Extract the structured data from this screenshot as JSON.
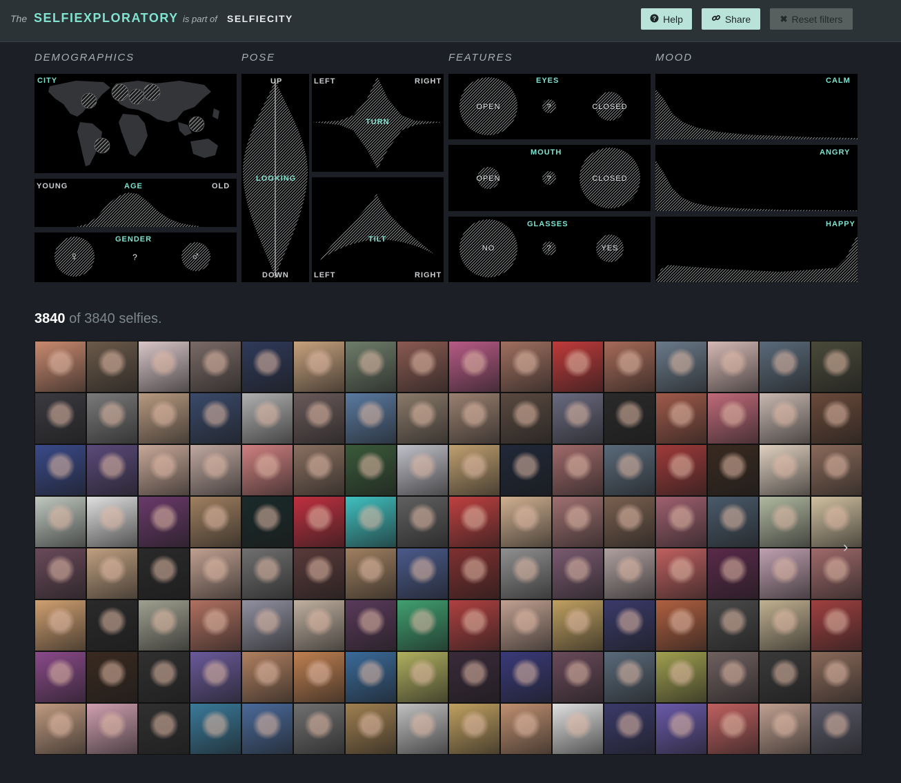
{
  "header": {
    "the": "The",
    "brand": "SELFIEXPLORATORY",
    "is_part_of": "is part of",
    "parent": "SELFIECITY",
    "help_label": "Help",
    "share_label": "Share",
    "reset_label": "Reset filters",
    "help_icon": "question-circle-icon",
    "share_icon": "link-icon",
    "reset_icon": "close-icon"
  },
  "sections": {
    "demographics": "DEMOGRAPHICS",
    "pose": "POSE",
    "features": "FEATURES",
    "mood": "MOOD"
  },
  "demographics": {
    "city_label": "CITY",
    "age_label": "AGE",
    "age_young": "YOUNG",
    "age_old": "OLD",
    "gender_label": "GENDER",
    "gender_female": "♀",
    "gender_unknown": "?",
    "gender_male": "♂"
  },
  "pose": {
    "looking_label": "LOOKING",
    "up": "UP",
    "down": "DOWN",
    "turn_label": "TURN",
    "turn_left": "LEFT",
    "turn_right": "RIGHT",
    "tilt_label": "TILT",
    "tilt_left": "LEFT",
    "tilt_right": "RIGHT"
  },
  "features": {
    "eyes": {
      "label": "EYES",
      "a": "OPEN",
      "q": "?",
      "b": "CLOSED"
    },
    "mouth": {
      "label": "MOUTH",
      "a": "OPEN",
      "q": "?",
      "b": "CLOSED"
    },
    "glasses": {
      "label": "GLASSES",
      "a": "NO",
      "q": "?",
      "b": "YES"
    }
  },
  "mood": {
    "calm": "CALM",
    "angry": "ANGRY",
    "happy": "HAPPY"
  },
  "results": {
    "shown": "3840",
    "rest": "of 3840 selfies."
  },
  "colors": {
    "accent": "#7fe3cf",
    "button_bg": "#b9e2d8",
    "panel_bg": "#000000",
    "page_bg": "#1c2026"
  },
  "thumb_colors": [
    "#c98a6f",
    "#6b5a4a",
    "#d9c6c9",
    "#7a6a66",
    "#2f3a5a",
    "#c7a27d",
    "#6e7d6a",
    "#8a5a52",
    "#b85a86",
    "#a07060",
    "#c03a3a",
    "#a66a58",
    "#6a7a8a",
    "#d5b9b5",
    "#5a6a7a",
    "#4a4a3a",
    "#3a3a40",
    "#7a7a7a",
    "#b89a80",
    "#3a4a6a",
    "#b0b0b0",
    "#6a5a5a",
    "#5a7aa0",
    "#8a7a6a",
    "#9a8070",
    "#5a4a40",
    "#6a6a80",
    "#2a2a2a",
    "#a05a4a",
    "#c06a7a",
    "#c8b8b0",
    "#6a4a3a",
    "#3a4a8a",
    "#5a4a7a",
    "#c8a898",
    "#c0a8a0",
    "#d08080",
    "#8a7060",
    "#3a5a3a",
    "#c0c0c8",
    "#c0a070",
    "#202838",
    "#a06a6a",
    "#5a6a7a",
    "#a03a3a",
    "#3a2a20",
    "#e0d0c0",
    "#8a6a5a",
    "#c0c8c0",
    "#e0e0e0",
    "#6a3a6a",
    "#a08060",
    "#1a2a2a",
    "#c03040",
    "#40c0c0",
    "#606060",
    "#c04040",
    "#d0b090",
    "#a07070",
    "#7a6050",
    "#a06070",
    "#4a5a6a",
    "#b0b8a0",
    "#d0c0a0",
    "#6a4a5a",
    "#c0a080",
    "#2a2a2a",
    "#c0a090",
    "#707070",
    "#5a3a3a",
    "#a08060",
    "#4a5a8a",
    "#803030",
    "#909090",
    "#7a5a70",
    "#b0a0a0",
    "#c06060",
    "#5a2a4a",
    "#c0a0b0",
    "#a06a6a",
    "#d0a070",
    "#2a2a2a",
    "#a0a090",
    "#b07060",
    "#9090a0",
    "#c0b0a0",
    "#5a3a5a",
    "#40a070",
    "#b04040",
    "#c0a090",
    "#c0a060",
    "#3a3a6a",
    "#b06040",
    "#4a4a4a",
    "#c0b090",
    "#a04040",
    "#8a4a8a",
    "#3a2a20",
    "#303030",
    "#6a5a9a",
    "#b08060",
    "#c08050",
    "#3a6a9a",
    "#b0b060",
    "#3a2a3a",
    "#3a3a7a",
    "#6a4a5a",
    "#5a6a7a",
    "#a0a050",
    "#706060",
    "#3a3a3a",
    "#8a6a5a",
    "#c09a80",
    "#d0a0b0",
    "#303030",
    "#3a7a9a",
    "#4a6a9a",
    "#707070",
    "#a08050",
    "#c0c0c0",
    "#c0a060",
    "#c09070",
    "#e0e0e0",
    "#3a3a6a",
    "#6a5aaa",
    "#c06060",
    "#c0a090",
    "#5a5a6a"
  ]
}
